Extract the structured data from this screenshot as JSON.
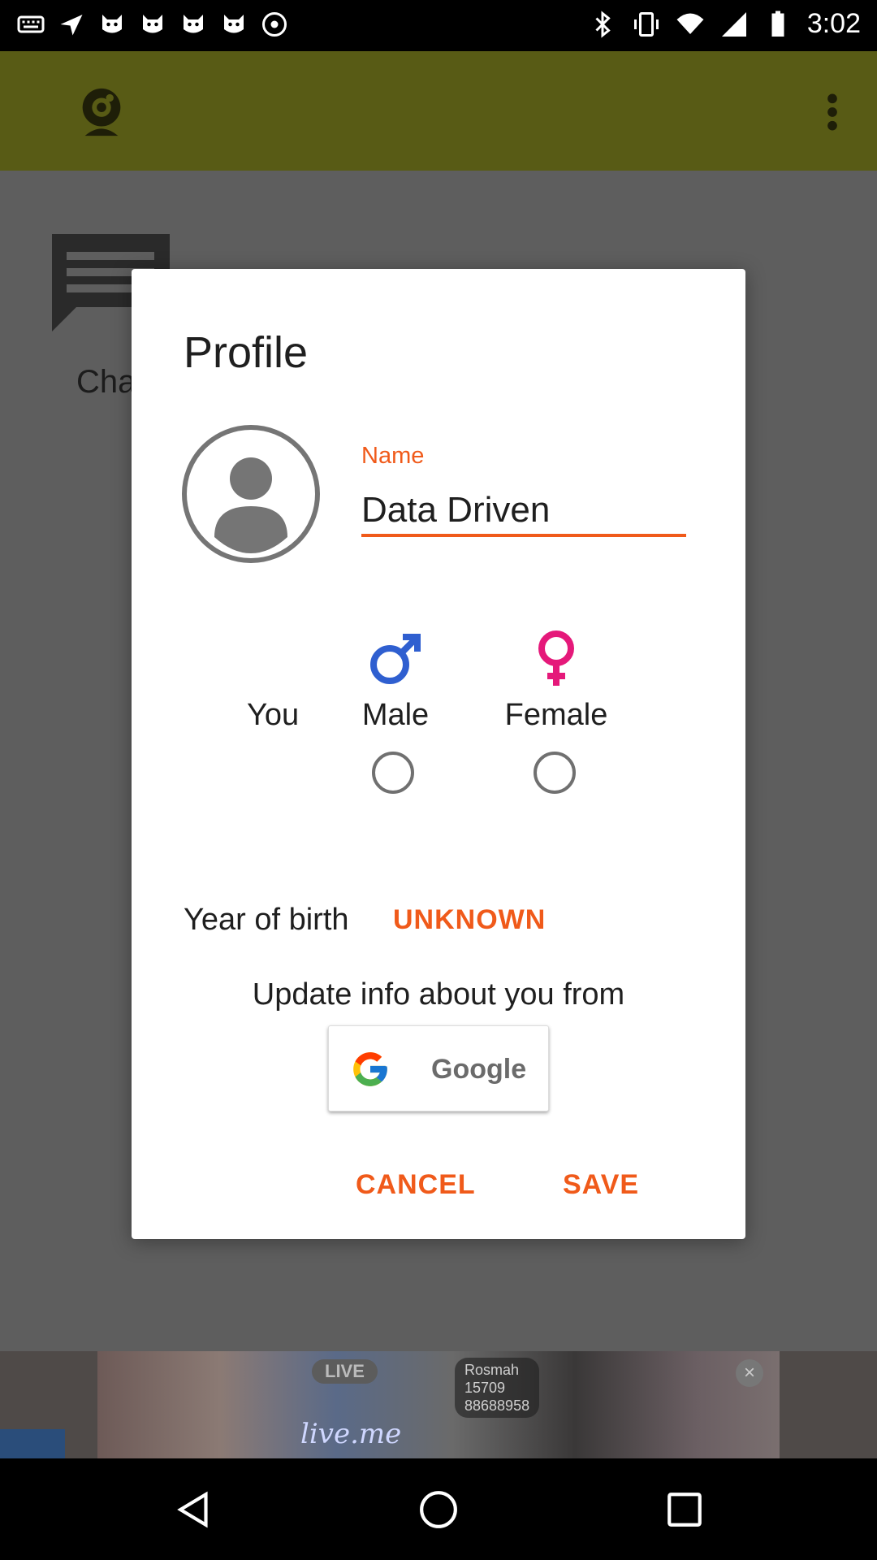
{
  "status_bar": {
    "time": "3:02",
    "icons": [
      "keyboard-icon",
      "send-icon",
      "cat-icon",
      "cat-icon",
      "cat-icon",
      "cat-icon",
      "fake-gps-icon",
      "bluetooth-icon",
      "vibrate-icon",
      "wifi-icon",
      "signal-icon",
      "battery-icon"
    ]
  },
  "app_bar": {
    "logo_icon": "webcam-icon",
    "menu_icon": "more-vert-icon"
  },
  "background": {
    "chat_icon": "chat-icon",
    "label": "Cha"
  },
  "dialog": {
    "title": "Profile",
    "avatar_icon": "account-circle-icon",
    "name_label": "Name",
    "name_value": "Data Driven",
    "you_label": "You",
    "male_label": "Male",
    "female_label": "Female",
    "male_selected": false,
    "female_selected": false,
    "year_of_birth_label": "Year of birth",
    "year_of_birth_value": "UNKNOWN",
    "update_text": "Update info about you from",
    "google_label": "Google",
    "cancel_label": "CANCEL",
    "save_label": "SAVE"
  },
  "ad": {
    "live_badge": "LIVE",
    "name_tag_line1": "Rosmah",
    "name_tag_line2": "15709",
    "name_tag_line3": "88688958",
    "brand": "live.me"
  },
  "colors": {
    "accent": "#f05a1a",
    "male_blue": "#2f5fd0",
    "female_pink": "#e5197a"
  }
}
